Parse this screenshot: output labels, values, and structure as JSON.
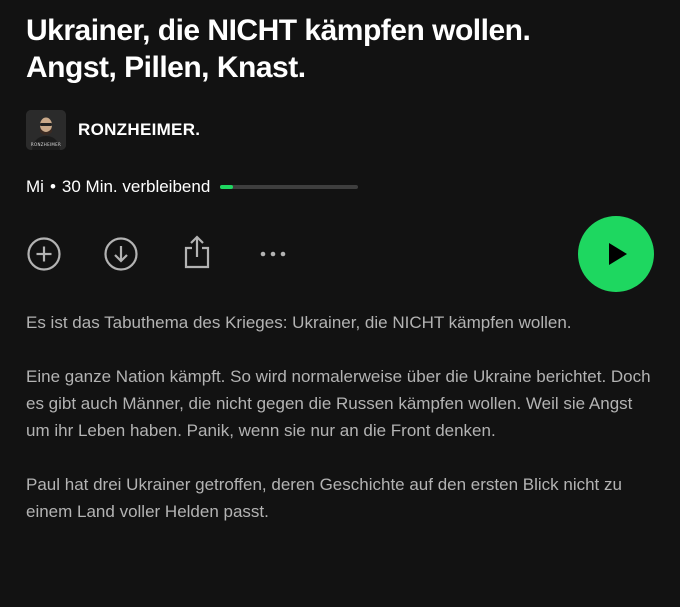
{
  "episode": {
    "title_lines": [
      "Ukrainer, die NICHT kämpfen wollen.",
      "Angst, Pillen, Knast."
    ]
  },
  "show": {
    "name": "RONZHEIMER.",
    "cover_text": "RONZHEIMER"
  },
  "meta": {
    "day": "Mi",
    "separator": "•",
    "remaining": "30 Min. verbleibend",
    "progress_fraction": 0.09
  },
  "icons": {
    "add": "add-circle-icon",
    "download": "download-icon",
    "share": "share-icon",
    "more": "more-icon",
    "play": "play-icon"
  },
  "colors": {
    "background": "#121212",
    "accent": "#1ed760",
    "text_secondary": "#b3b3b3"
  },
  "description": {
    "paragraphs": [
      "Es ist das Tabuthema des Krieges: Ukrainer, die NICHT kämpfen wollen.",
      "Eine ganze Nation kämpft. So wird normalerweise über die Ukraine berichtet. Doch es gibt auch Männer, die nicht gegen die Russen kämpfen wollen. Weil sie Angst um ihr Leben haben. Panik, wenn sie nur an die Front denken.",
      "Paul hat drei Ukrainer getroffen, deren Geschichte auf den ersten Blick nicht zu einem Land voller Helden passt."
    ]
  }
}
